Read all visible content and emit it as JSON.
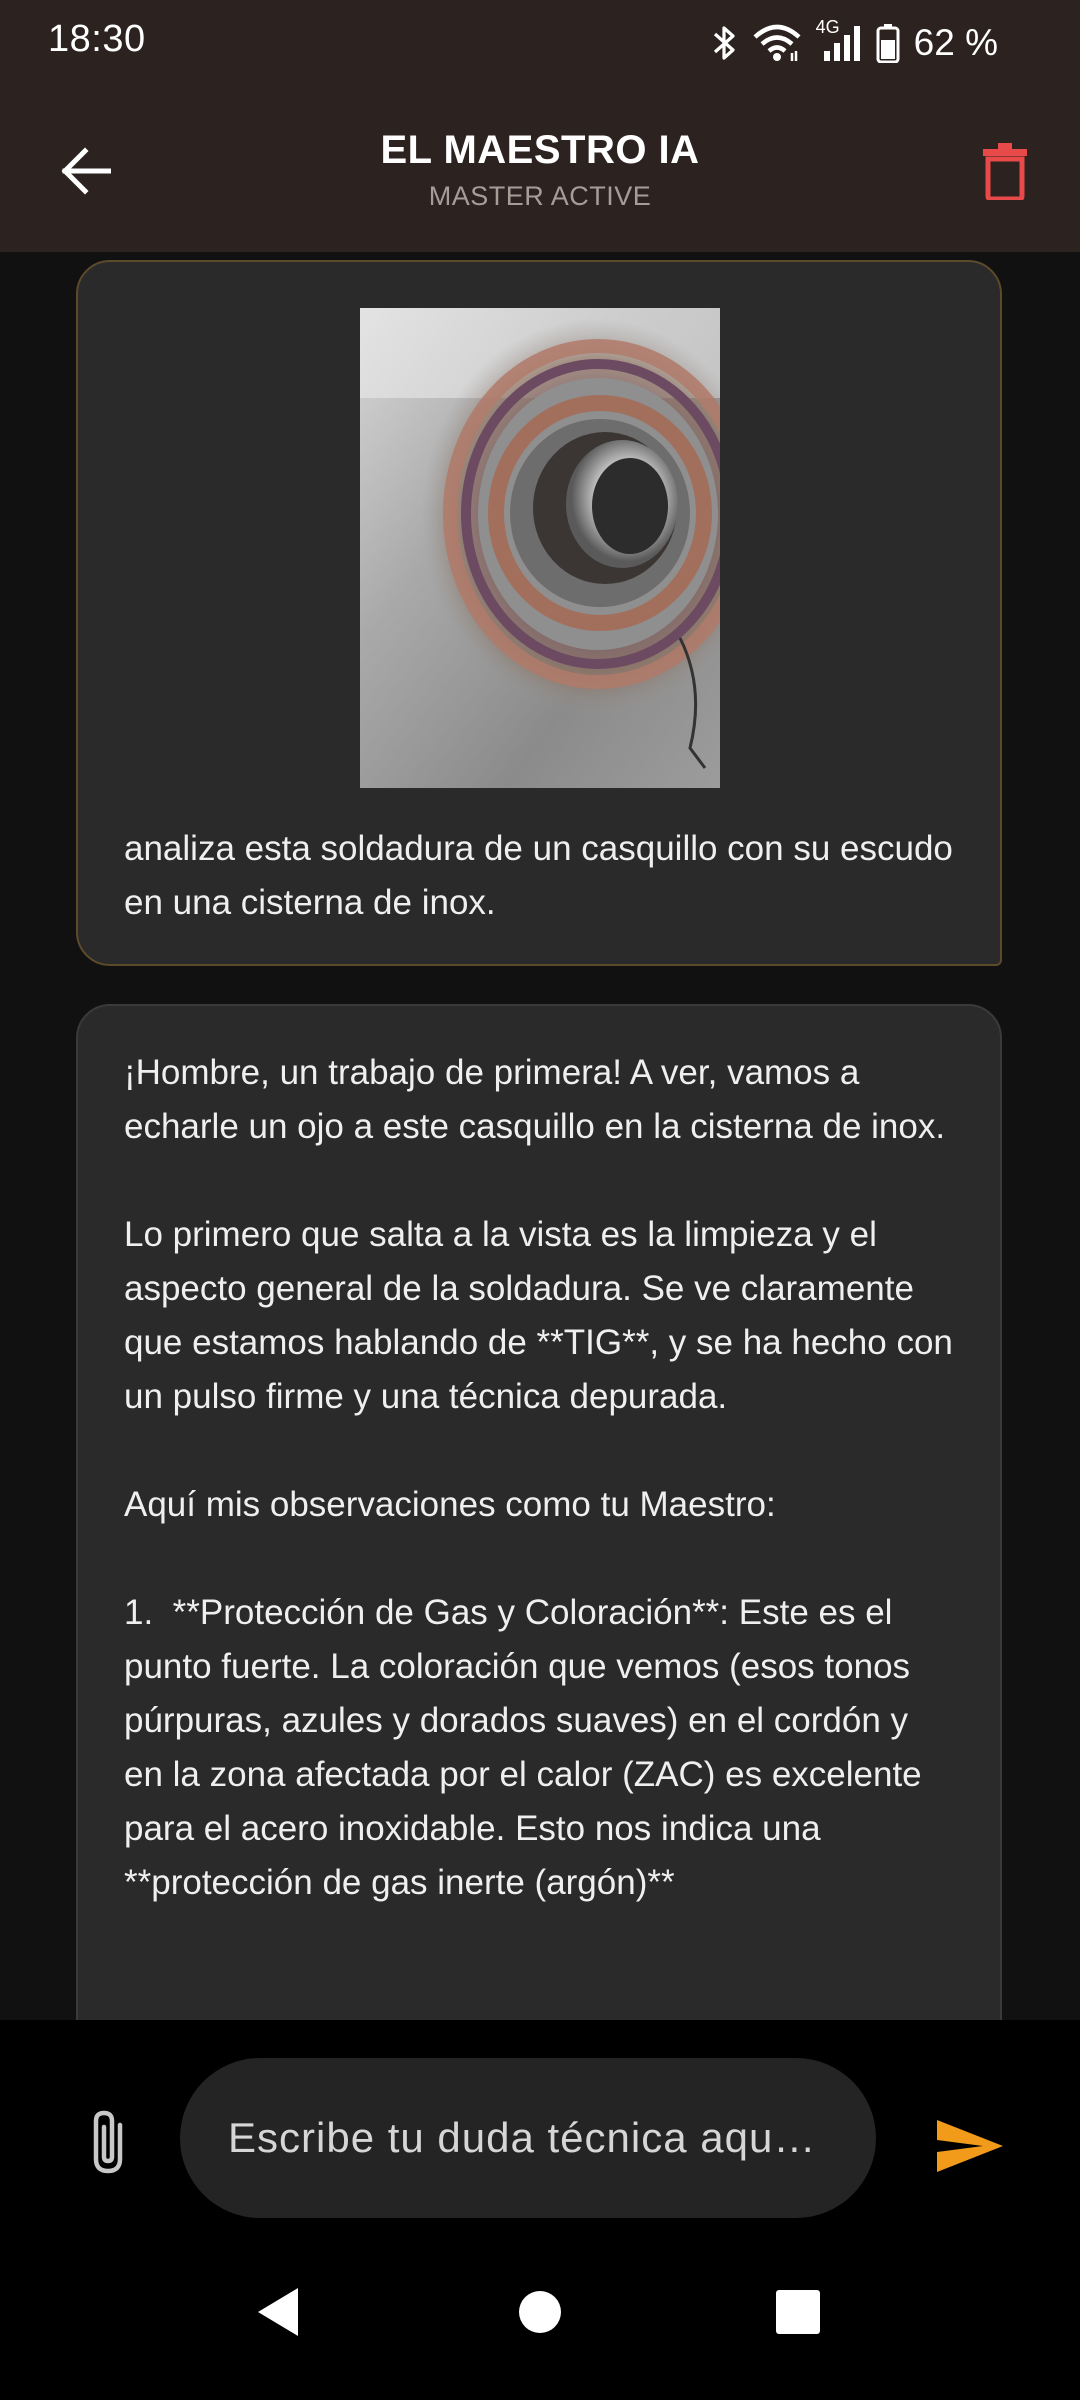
{
  "status_bar": {
    "time": "18:30",
    "battery_percent": "62 %",
    "network_label": "4G",
    "icons": [
      "bluetooth-icon",
      "wifi-icon",
      "cellular-signal-icon",
      "battery-icon"
    ]
  },
  "app_bar": {
    "title": "EL MAESTRO IA",
    "subtitle": "MASTER ACTIVE",
    "back_icon": "arrow-left-icon",
    "delete_icon": "trash-icon",
    "colors": {
      "background": "#2c2320",
      "delete": "#e84a4a"
    }
  },
  "messages": [
    {
      "role": "user",
      "has_image": true,
      "image_subject": "weld-photo",
      "text": "analiza esta soldadura de un casquillo con su escudo en una cisterna de inox."
    },
    {
      "role": "assistant",
      "text": "¡Hombre, un trabajo de primera! A ver, vamos a echarle un ojo a este casquillo en la cisterna de inox.\n\nLo primero que salta a la vista es la limpieza y el aspecto general de la soldadura. Se ve claramente que estamos hablando de **TIG**, y se ha hecho con un pulso firme y una técnica depurada.\n\nAquí mis observaciones como tu Maestro:\n\n1.  **Protección de Gas y Coloración**: Este es el punto fuerte. La coloración que vemos (esos tonos púrpuras, azules y dorados suaves) en el cordón y en la zona afectada por el calor (ZAC) es excelente para el acero inoxidable. Esto nos indica una **protección de gas inerte (argón)**"
    }
  ],
  "composer": {
    "placeholder": "Escribe tu duda técnica aqu…",
    "attach_icon": "paperclip-icon",
    "send_icon": "send-icon",
    "colors": {
      "send": "#f29a1a"
    }
  },
  "nav_bar": {
    "icons": [
      "back-triangle-icon",
      "home-circle-icon",
      "recents-square-icon"
    ]
  }
}
